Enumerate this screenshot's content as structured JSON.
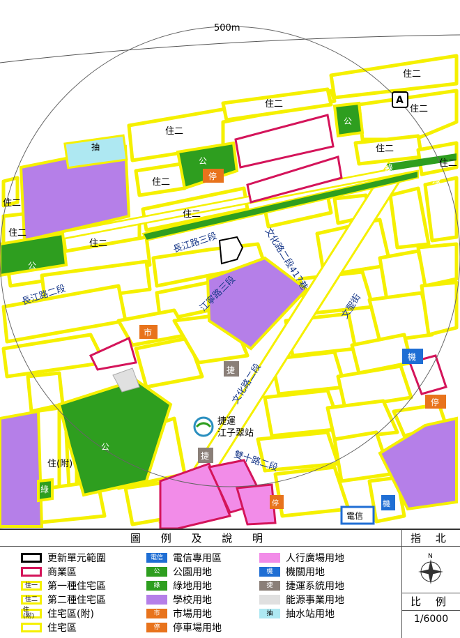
{
  "map": {
    "radius_label": "500m",
    "zone_labels": {
      "zhu_er": "住二",
      "zhu_fu": "住(附)",
      "park": "公",
      "green": "綠",
      "parking": "停",
      "market": "市",
      "pump": "抽",
      "mrt": "捷",
      "agency": "機",
      "telecom": "電信"
    },
    "roads": {
      "changjiang_3": "長江路三段",
      "changjiang_2": "長江路二段",
      "jiangning_3": "江寧路三段",
      "wenhua_2": "文化路二段",
      "wenhua_2_417": "文化路二段417巷",
      "wensheng": "文聖街",
      "shuangshi_2": "雙十路二段"
    },
    "station": {
      "line1": "捷運",
      "line2": "江子翠站"
    },
    "marker": "A"
  },
  "legend": {
    "title": "圖 例 及 說 明",
    "north_title": "指 北",
    "north_letter": "N",
    "scale_title": "比 例",
    "scale_value": "1/6000",
    "items": [
      {
        "label": "更新單元範圍",
        "tag": "",
        "fill": "#ffffff",
        "border": "#000000"
      },
      {
        "label": "商業區",
        "tag": "",
        "fill": "#ffffff",
        "border": "#d4145a"
      },
      {
        "label": "第一種住宅區",
        "tag": "住一",
        "fill": "#ffffff",
        "border": "#f5f000"
      },
      {
        "label": "第二種住宅區",
        "tag": "住二",
        "fill": "#ffffff",
        "border": "#f5f000"
      },
      {
        "label": "住宅區(附)",
        "tag": "住(附)",
        "fill": "#ffffff",
        "border": "#f5f000"
      },
      {
        "label": "住宅區",
        "tag": "",
        "fill": "#ffffff",
        "border": "#f5f000"
      },
      {
        "label": "電信專用區",
        "tag": "電信",
        "fill": "#1f6ed4",
        "border": "#1f6ed4"
      },
      {
        "label": "公園用地",
        "tag": "公",
        "fill": "#2e9e1f",
        "border": "#2e9e1f"
      },
      {
        "label": "綠地用地",
        "tag": "綠",
        "fill": "#2e9e1f",
        "border": "#2e9e1f"
      },
      {
        "label": "學校用地",
        "tag": "",
        "fill": "#b57fe8",
        "border": "#b57fe8"
      },
      {
        "label": "市場用地",
        "tag": "市",
        "fill": "#e8731c",
        "border": "#e8731c"
      },
      {
        "label": "停車場用地",
        "tag": "停",
        "fill": "#e8731c",
        "border": "#e8731c"
      },
      {
        "label": "人行廣場用地",
        "tag": "",
        "fill": "#f28ce8",
        "border": "#f28ce8"
      },
      {
        "label": "機關用地",
        "tag": "機",
        "fill": "#1f6ed4",
        "border": "#1f6ed4"
      },
      {
        "label": "捷運系統用地",
        "tag": "捷",
        "fill": "#8a7f78",
        "border": "#8a7f78"
      },
      {
        "label": "能源事業用地",
        "tag": "",
        "fill": "#e0e0e0",
        "border": "#e0e0e0"
      },
      {
        "label": "抽水站用地",
        "tag": "抽",
        "fill": "#aee8f2",
        "border": "#aee8f2"
      }
    ]
  },
  "colors": {
    "yellow": "#f5f000",
    "purple": "#b57fe8",
    "green": "#2e9e1f",
    "red": "#d4145a",
    "orange": "#e8731c",
    "blue": "#1f6ed4",
    "pink": "#f28ce8",
    "grey": "#8a7f78",
    "cyan": "#aee8f2"
  }
}
